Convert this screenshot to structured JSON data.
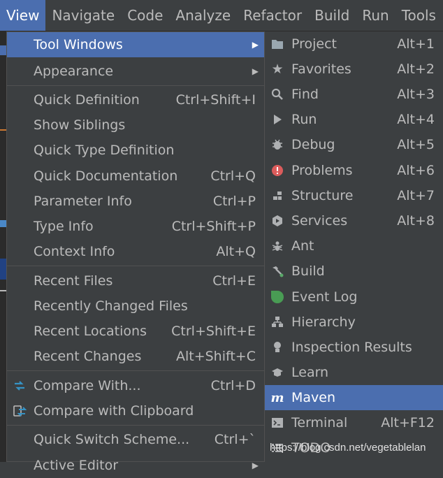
{
  "menubar": [
    "View",
    "Navigate",
    "Code",
    "Analyze",
    "Refactor",
    "Build",
    "Run",
    "Tools"
  ],
  "view_menu": {
    "items": [
      {
        "label": "Tool Windows",
        "shortcut": "",
        "submenu": true
      },
      {
        "label": "Appearance",
        "shortcut": "",
        "submenu": true
      },
      {
        "label": "Quick Definition",
        "shortcut": "Ctrl+Shift+I"
      },
      {
        "label": "Show Siblings",
        "shortcut": ""
      },
      {
        "label": "Quick Type Definition",
        "shortcut": ""
      },
      {
        "label": "Quick Documentation",
        "shortcut": "Ctrl+Q"
      },
      {
        "label": "Parameter Info",
        "shortcut": "Ctrl+P"
      },
      {
        "label": "Type Info",
        "shortcut": "Ctrl+Shift+P"
      },
      {
        "label": "Context Info",
        "shortcut": "Alt+Q"
      },
      {
        "label": "Recent Files",
        "shortcut": "Ctrl+E"
      },
      {
        "label": "Recently Changed Files",
        "shortcut": ""
      },
      {
        "label": "Recent Locations",
        "shortcut": "Ctrl+Shift+E"
      },
      {
        "label": "Recent Changes",
        "shortcut": "Alt+Shift+C"
      },
      {
        "label": "Compare With...",
        "shortcut": "Ctrl+D"
      },
      {
        "label": "Compare with Clipboard",
        "shortcut": ""
      },
      {
        "label": "Quick Switch Scheme...",
        "shortcut": "Ctrl+`"
      },
      {
        "label": "Active Editor",
        "shortcut": "",
        "submenu": true
      }
    ]
  },
  "tool_windows": {
    "items": [
      {
        "label": "Project",
        "shortcut": "Alt+1",
        "icon": "folder-icon"
      },
      {
        "label": "Favorites",
        "shortcut": "Alt+2",
        "icon": "star-icon"
      },
      {
        "label": "Find",
        "shortcut": "Alt+3",
        "icon": "search-icon"
      },
      {
        "label": "Run",
        "shortcut": "Alt+4",
        "icon": "play-icon"
      },
      {
        "label": "Debug",
        "shortcut": "Alt+5",
        "icon": "bug-icon"
      },
      {
        "label": "Problems",
        "shortcut": "Alt+6",
        "icon": "error-icon"
      },
      {
        "label": "Structure",
        "shortcut": "Alt+7",
        "icon": "structure-icon"
      },
      {
        "label": "Services",
        "shortcut": "Alt+8",
        "icon": "services-icon"
      },
      {
        "label": "Ant",
        "shortcut": "",
        "icon": "ant-icon"
      },
      {
        "label": "Build",
        "shortcut": "",
        "icon": "hammer-icon"
      },
      {
        "label": "Event Log",
        "shortcut": "",
        "icon": "event-log-icon"
      },
      {
        "label": "Hierarchy",
        "shortcut": "",
        "icon": "hierarchy-icon"
      },
      {
        "label": "Inspection Results",
        "shortcut": "",
        "icon": "inspection-icon"
      },
      {
        "label": "Learn",
        "shortcut": "",
        "icon": "graduation-cap-icon"
      },
      {
        "label": "Maven",
        "shortcut": "",
        "icon": "maven-icon"
      },
      {
        "label": "Terminal",
        "shortcut": "Alt+F12",
        "icon": "terminal-icon"
      },
      {
        "label": "TODO",
        "shortcut": "",
        "icon": "todo-icon"
      }
    ]
  },
  "watermark": "https://blog.csdn.net/vegetablelan",
  "colors": {
    "selection": "#4b6eaf",
    "background": "#3c3f41",
    "text": "#bbbbbb"
  }
}
